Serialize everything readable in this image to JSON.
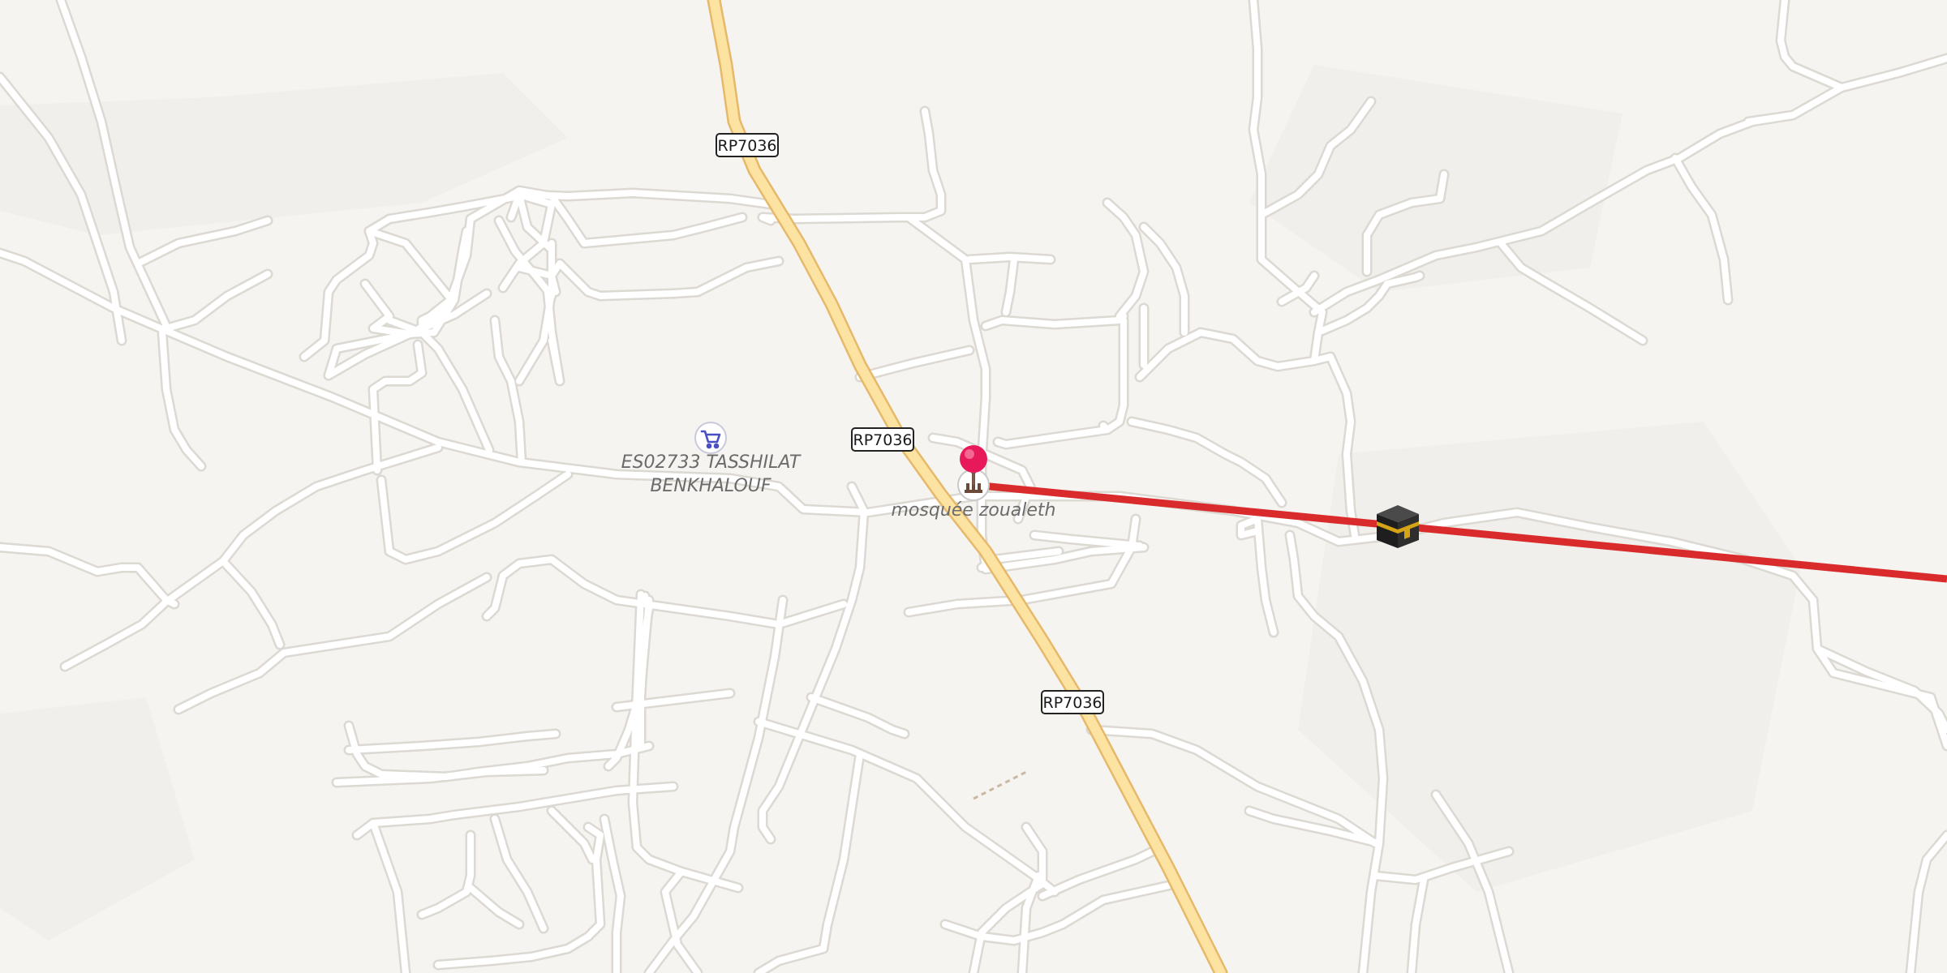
{
  "map": {
    "roads": {
      "highway": {
        "ref": "RP7036"
      }
    },
    "labels": {
      "shop_line1": "ES02733 TASSHILAT",
      "shop_line2": "BENKHALOUF",
      "mosque": "mosquée zoualeth"
    },
    "icons": {
      "shop": "shopping-cart-icon",
      "mosque": "mosque-icon",
      "pin": "location-pin-icon",
      "qibla_target": "kaaba-icon"
    },
    "colors": {
      "background": "#f6f4f1",
      "road": "#ffffff",
      "road_casing": "#dcd8d2",
      "highway": "#fde3a1",
      "highway_casing": "#e6b96a",
      "qibla_line": "#d92b2b",
      "pin": "#e8195b",
      "shop_icon": "#4a4fc4"
    }
  }
}
